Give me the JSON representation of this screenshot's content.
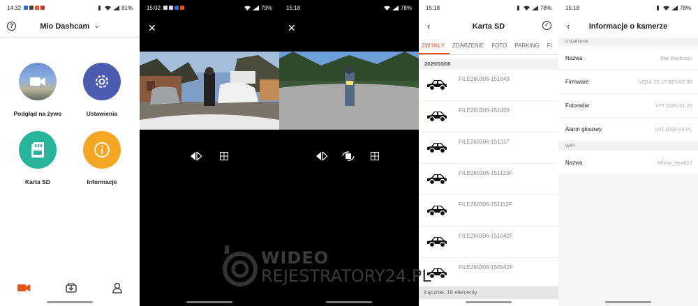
{
  "screens": [
    {
      "status": {
        "time": "14:32",
        "battery": "81%"
      },
      "header": {
        "title": "Mio Dashcam",
        "help_icon": "help-icon"
      },
      "tiles": [
        {
          "label": "Podgląd na żywo",
          "icon": "live-view-icon",
          "color": "#5b6fb8"
        },
        {
          "label": "Ustawienia",
          "icon": "settings-gear-icon",
          "color": "#4b5bb0"
        },
        {
          "label": "Karta SD",
          "icon": "sd-card-icon",
          "color": "#26b49a"
        },
        {
          "label": "Informacje",
          "icon": "info-icon",
          "color": "#f5a623"
        }
      ],
      "bottom_nav": [
        {
          "icon": "camera-icon",
          "color": "#e8531b"
        },
        {
          "icon": "download-icon",
          "color": "#444444"
        },
        {
          "icon": "profile-icon",
          "color": "#444444"
        }
      ]
    },
    {
      "status": {
        "time": "15:02",
        "battery": "79%"
      },
      "close_icon": "close-icon",
      "controls": [
        "mirror-icon",
        "grid-icon"
      ]
    },
    {
      "status": {
        "time": "15:18",
        "battery": "78%"
      },
      "close_icon": "close-icon",
      "controls": [
        "mirror-icon",
        "rotate-icon",
        "grid-icon"
      ]
    },
    {
      "status": {
        "time": "15:18",
        "battery": "78%"
      },
      "header": {
        "title": "Karta SD"
      },
      "tabs": [
        "ZWYKŁY",
        "ZDARZENIE",
        "FOTO",
        "PARKING",
        "FI"
      ],
      "date": "2026/03/06",
      "files": [
        "FILE260306-151649",
        "FILE260306-151458",
        "FILE260306-151317",
        "FILE260306-151133F",
        "FILE260306-151112F",
        "FILE260306-151042F",
        "FILE260306-150942F"
      ],
      "footer": "Łącznie: 16 elementy"
    },
    {
      "status": {
        "time": "15:18",
        "battery": "78%"
      },
      "header": {
        "title": "Informacje o kamerze"
      },
      "sections": [
        {
          "title": "Urządzenie",
          "rows": [
            {
              "key": "Nazwa",
              "value": "Mio Dashcam"
            },
            {
              "key": "Firmware",
              "value": "VQ14.12.17.BE1AD.38"
            },
            {
              "key": "Fotoradar",
              "value": "V77.0205.01.25"
            },
            {
              "key": "Alarm głosowy",
              "value": "V01.0330.03.PL"
            }
          ]
        },
        {
          "title": "WIFI",
          "rows": [
            {
              "key": "Nazwa",
              "value": "MiVue_be4817"
            }
          ]
        }
      ]
    }
  ],
  "watermark": {
    "line1": "WIDEO",
    "line2": "REJESTRATORY24.PL"
  }
}
